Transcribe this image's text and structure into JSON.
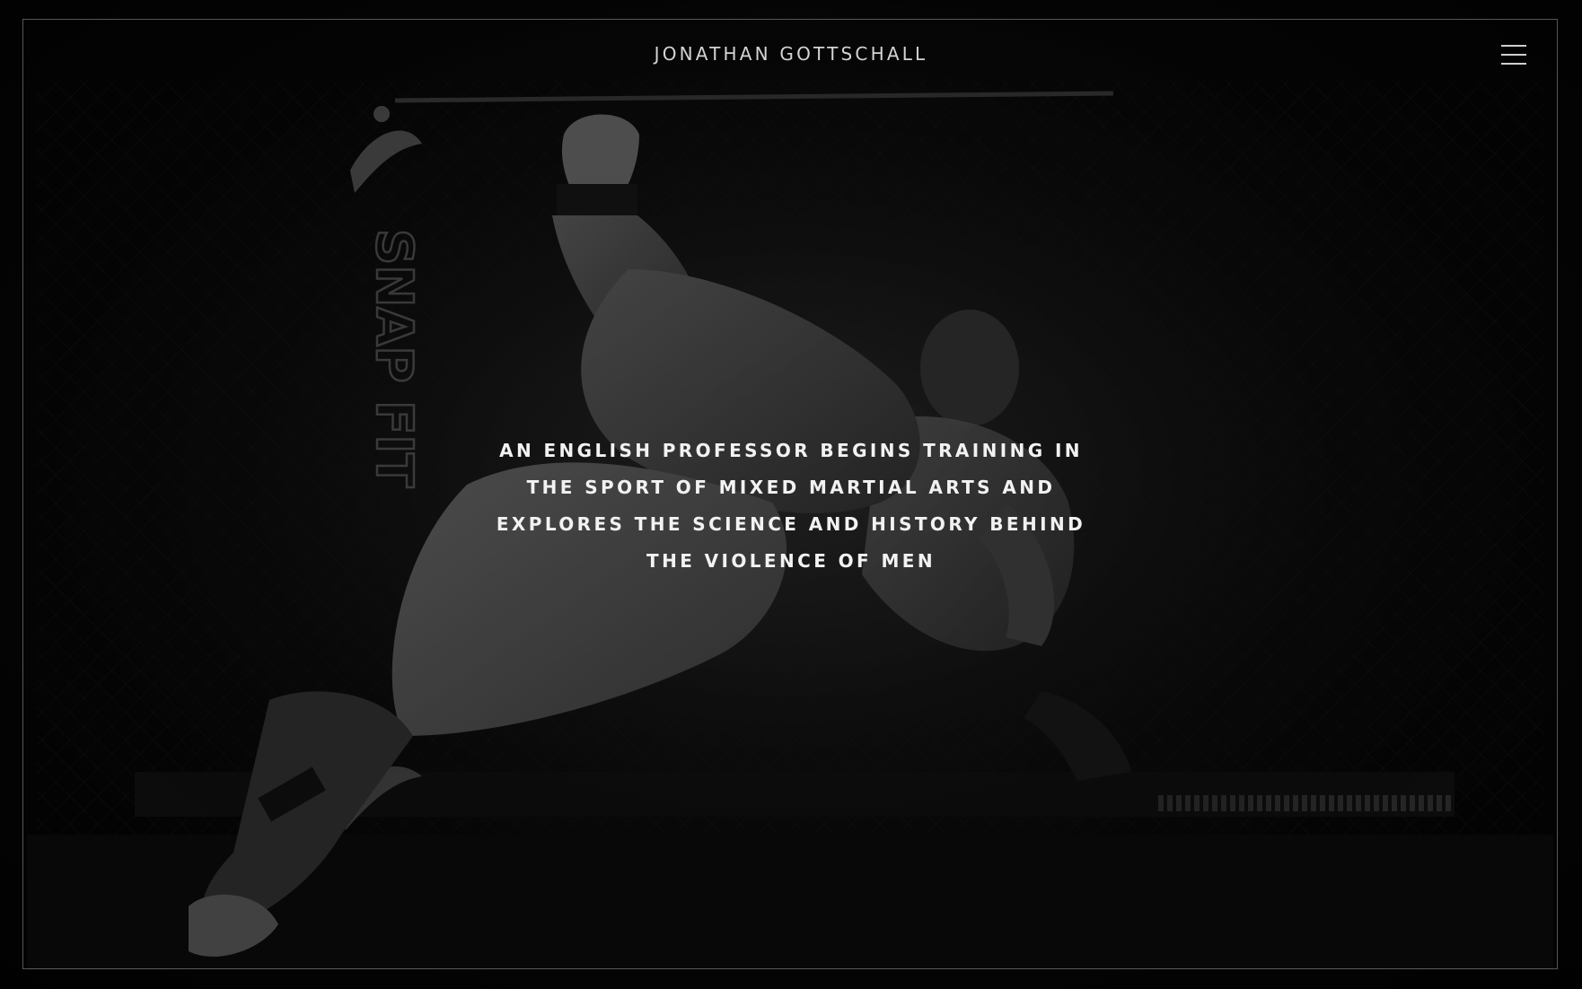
{
  "header": {
    "site_title": "JONATHAN GOTTSCHALL",
    "menu_icon": "hamburger-menu-icon"
  },
  "hero": {
    "image_subject": "mma-fighters-takedown-photo",
    "tagline_lines": [
      "AN ENGLISH PROFESSOR BEGINS TRAINING IN",
      "THE SPORT OF MIXED MARTIAL ARTS AND",
      "EXPLORES THE SCIENCE AND HISTORY BEHIND",
      "THE VIOLENCE OF MEN"
    ],
    "banner_text": "SNAP FIT"
  },
  "colors": {
    "background": "#050505",
    "text": "#f2f2f2",
    "frame": "#9a9a9a"
  }
}
